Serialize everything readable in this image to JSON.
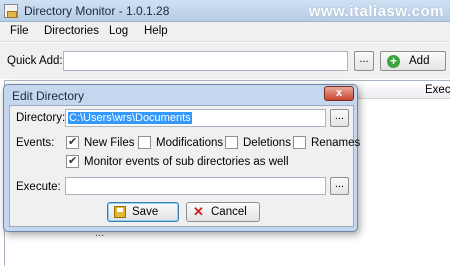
{
  "window": {
    "title": "Directory Monitor - 1.0.1.28",
    "watermark": "www.italiasw.com"
  },
  "menu": [
    "File",
    "Directories",
    "Log",
    "Help"
  ],
  "toolbar": {
    "quick_add_label": "Quick Add:",
    "quick_add_value": "",
    "browse_label": "...",
    "add_label": "Add"
  },
  "list": {
    "column_execute": "Execute",
    "background_text": "..."
  },
  "dialog": {
    "title": "Edit Directory",
    "close_label": "x",
    "directory_label": "Directory:",
    "directory_value": "C:\\Users\\wrs\\Documents",
    "browse_label": "...",
    "events_label": "Events:",
    "events": [
      {
        "label": "New Files",
        "checked": true
      },
      {
        "label": "Modifications",
        "checked": false
      },
      {
        "label": "Deletions",
        "checked": false
      },
      {
        "label": "Renames",
        "checked": false
      }
    ],
    "subdirs_label": "Monitor events of sub directories as well",
    "subdirs_checked": true,
    "execute_label": "Execute:",
    "execute_value": "",
    "save_label": "Save",
    "cancel_label": "Cancel"
  }
}
